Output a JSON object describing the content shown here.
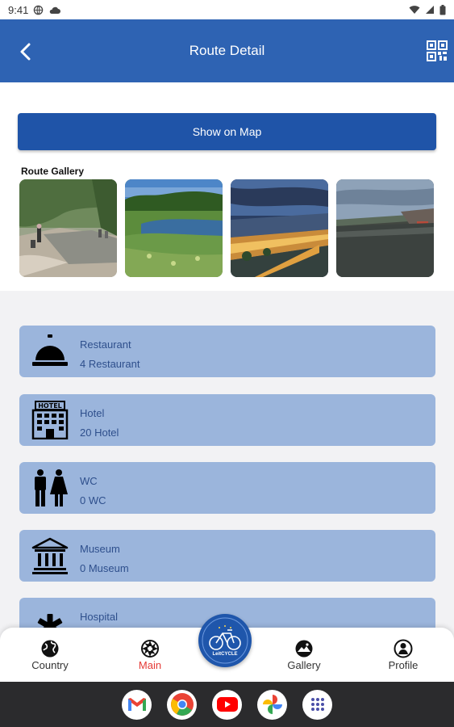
{
  "status_bar": {
    "time": "9:41"
  },
  "app_bar": {
    "title": "Route Detail"
  },
  "show_on_map_label": "Show on Map",
  "gallery": {
    "label": "Route Gallery",
    "photos": [
      "river-hikers",
      "wetland-lake",
      "city-night",
      "river-town"
    ]
  },
  "amenities": [
    {
      "name": "Restaurant",
      "count": "4 Restaurant",
      "icon": "service-bell-icon"
    },
    {
      "name": "Hotel",
      "count": "20 Hotel",
      "icon": "hotel-building-icon"
    },
    {
      "name": "WC",
      "count": "0 WC",
      "icon": "restroom-icon"
    },
    {
      "name": "Museum",
      "count": "0 Museum",
      "icon": "museum-icon"
    },
    {
      "name": "Hospital",
      "count": "",
      "icon": "medical-star-icon"
    }
  ],
  "bottom_nav": {
    "items": [
      {
        "label": "Country",
        "icon": "globe-icon",
        "active": false
      },
      {
        "label": "Main",
        "icon": "aperture-icon",
        "active": true
      },
      {
        "label": "Gallery",
        "icon": "landscape-icon",
        "active": false
      },
      {
        "label": "Profile",
        "icon": "person-icon",
        "active": false
      }
    ],
    "center_logo": "LeitCYCLE"
  },
  "system_dock": {
    "apps": [
      "gmail-icon",
      "chrome-icon",
      "youtube-icon",
      "photos-icon",
      "app-drawer-icon"
    ]
  },
  "colors": {
    "primary": "#2e63b3",
    "button": "#1f54a8",
    "card": "#9bb5dc",
    "card_text": "#2e4f8c",
    "active_nav": "#e53935"
  }
}
